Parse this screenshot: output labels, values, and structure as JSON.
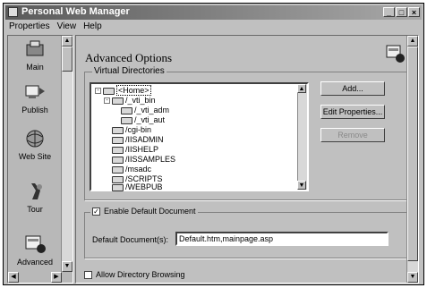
{
  "window": {
    "title": "Personal Web Manager",
    "controls": [
      "_",
      "□",
      "×"
    ]
  },
  "menu": [
    {
      "label": "Properties",
      "accel": "P"
    },
    {
      "label": "View",
      "accel": "V"
    },
    {
      "label": "Help",
      "accel": "H"
    }
  ],
  "sidebar": {
    "items": [
      {
        "label": "Main",
        "icon": "main-icon"
      },
      {
        "label": "Publish",
        "icon": "publish-icon"
      },
      {
        "label": "Web Site",
        "icon": "globe-icon"
      },
      {
        "label": "Tour",
        "icon": "tour-icon"
      },
      {
        "label": "Advanced",
        "icon": "advanced-icon"
      }
    ]
  },
  "panel": {
    "title": "Advanced Options",
    "virtual_dirs_label": "Virtual Directories",
    "tree": [
      {
        "label": "<Home>",
        "level": 0,
        "expander": "-",
        "selected": true
      },
      {
        "label": "/_vti_bin",
        "level": 1,
        "expander": "-"
      },
      {
        "label": "/_vti_adm",
        "level": 2,
        "expander": ""
      },
      {
        "label": "/_vti_aut",
        "level": 2,
        "expander": ""
      },
      {
        "label": "/cgi-bin",
        "level": 1,
        "expander": ""
      },
      {
        "label": "/IISADMIN",
        "level": 1,
        "expander": ""
      },
      {
        "label": "/IISHELP",
        "level": 1,
        "expander": ""
      },
      {
        "label": "/IISSAMPLES",
        "level": 1,
        "expander": ""
      },
      {
        "label": "/msadc",
        "level": 1,
        "expander": ""
      },
      {
        "label": "/SCRIPTS",
        "level": 1,
        "expander": ""
      },
      {
        "label": "/WEBPUB",
        "level": 1,
        "expander": ""
      }
    ],
    "buttons": {
      "add": "Add...",
      "edit": "Edit Properties...",
      "remove": "Remove"
    },
    "enable_default_doc": {
      "label": "Enable Default Document",
      "checked": true
    },
    "default_doc": {
      "label": "Default Document(s):",
      "value": "Default.htm,mainpage.asp"
    },
    "allow_browsing": {
      "label": "Allow Directory Browsing",
      "checked": false
    }
  }
}
